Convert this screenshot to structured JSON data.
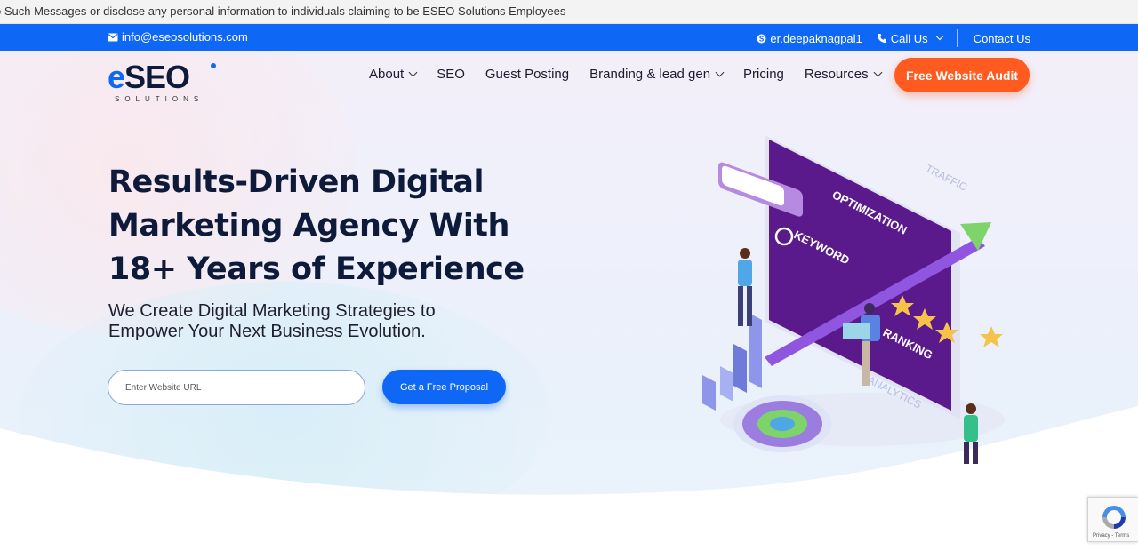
{
  "notice": {
    "text": "o Such Messages or disclose any personal information to individuals claiming to be ESEO Solutions Employees"
  },
  "topbar": {
    "email": "info@eseosolutions.com",
    "skype": "er.deepaknagpal1",
    "call": "Call Us",
    "contact": "Contact Us"
  },
  "logo": {
    "e": "e",
    "rest": "SEO",
    "sub": "SOLUTIONS"
  },
  "nav": {
    "items": [
      {
        "label": "About",
        "dropdown": true
      },
      {
        "label": "SEO",
        "dropdown": false
      },
      {
        "label": "Guest Posting",
        "dropdown": false
      },
      {
        "label": "Branding & lead gen",
        "dropdown": true
      },
      {
        "label": "Pricing",
        "dropdown": false
      },
      {
        "label": "Resources",
        "dropdown": true
      }
    ],
    "cta": "Free Website Audit"
  },
  "hero": {
    "headline_1": "Results-Driven Digital",
    "headline_2": "Marketing Agency With",
    "headline_3": "18+ Years of Experience",
    "subline_1": "We Create Digital Marketing Strategies to",
    "subline_2": "Empower Your Next Business Evolution.",
    "url_placeholder": "Enter Website URL",
    "proposal_button": "Get a Free Proposal"
  },
  "illustration": {
    "traffic": "TRAFFIC",
    "optimization": "OPTIMIZATION",
    "keyword": "KEYWORD",
    "ranking": "RANKING",
    "analytics": "ANALYTICS"
  },
  "recaptcha": {
    "links": "Privacy - Terms"
  },
  "colors": {
    "brand_blue": "#0f68f5",
    "cta_orange": "#ff5a1f",
    "navy": "#0e1a3a",
    "purple": "#5a1a8a"
  }
}
